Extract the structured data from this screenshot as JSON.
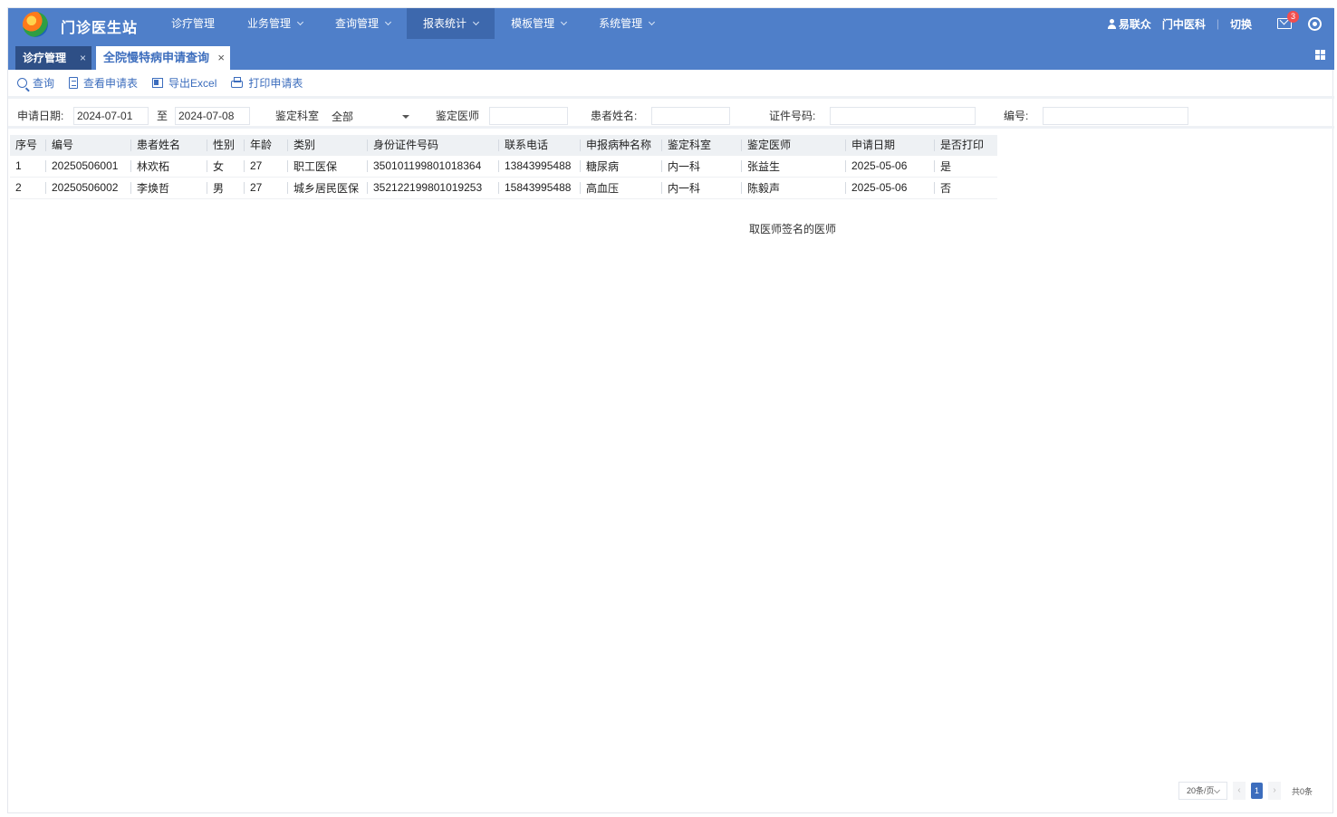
{
  "app": {
    "title": "门诊医生站"
  },
  "nav": {
    "items": [
      {
        "label": "诊疗管理"
      },
      {
        "label": "业务管理"
      },
      {
        "label": "查询管理"
      },
      {
        "label": "报表统计"
      },
      {
        "label": "模板管理"
      },
      {
        "label": "系统管理"
      }
    ],
    "active": "报表统计"
  },
  "user": {
    "name": "易联众",
    "department": "门中医科",
    "switch_label": "切换",
    "notification_count": "3"
  },
  "tabs": [
    {
      "label": "诊疗管理",
      "close": "×"
    },
    {
      "label": "全院慢特病申请查询",
      "close": "×"
    }
  ],
  "toolbar": {
    "query": "查询",
    "view": "查看申请表",
    "export": "导出Excel",
    "print": "打印申请表"
  },
  "filters": {
    "date_label": "申请日期:",
    "date_from": "2024-07-01",
    "to_label": "至",
    "date_to": "2024-07-08",
    "dept_label": "鉴定科室",
    "dept_value": "全部",
    "doctor_label": "鉴定医师",
    "doctor_value": "",
    "patient_label": "患者姓名:",
    "patient_value": "",
    "id_label": "证件号码:",
    "id_value": "",
    "code_label": "编号:",
    "code_value": ""
  },
  "table": {
    "headers": [
      "序号",
      "编号",
      "患者姓名",
      "性别",
      "年龄",
      "类别",
      "身份证件号码",
      "联系电话",
      "申报病种名称",
      "鉴定科室",
      "鉴定医师",
      "申请日期",
      "是否打印"
    ],
    "rows": [
      [
        "1",
        "20250506001",
        "林欢柘",
        "女",
        "27",
        "职工医保",
        "350101199801018364",
        "13843995488",
        "糖尿病",
        "内一科",
        "张益生",
        "2025-05-06",
        "是"
      ],
      [
        "2",
        "20250506002",
        "李焕哲",
        "男",
        "27",
        "城乡居民医保",
        "352122199801019253",
        "15843995488",
        "高血压",
        "内一科",
        "陈毅声",
        "2025-05-06",
        "否"
      ]
    ]
  },
  "note": "取医师签名的医师",
  "pagination": {
    "page_size": "20条/页",
    "prev": "‹",
    "current": "1",
    "next": "›",
    "total": "共0条"
  },
  "colors": {
    "primary": "#4f7fc9",
    "active_nav": "#3d68ad",
    "dark_tab": "#2e4f86",
    "link": "#3c6dbd",
    "badge": "#f14e4e"
  }
}
